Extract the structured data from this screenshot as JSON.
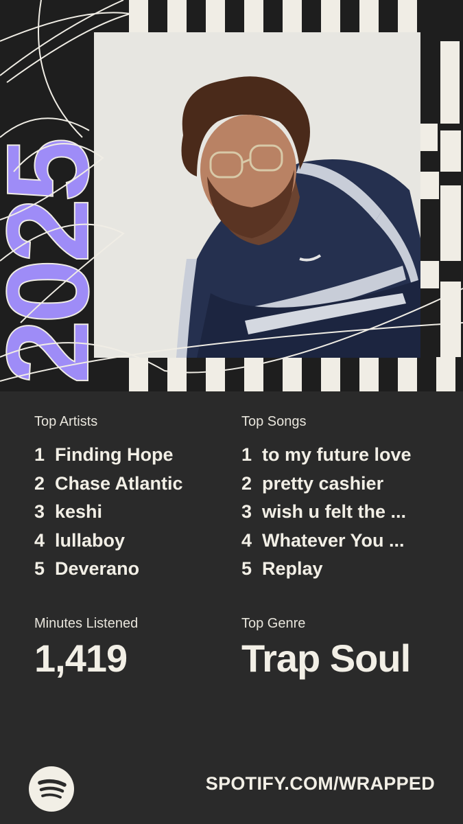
{
  "year": "2025",
  "top_artists": {
    "label": "Top Artists",
    "items": [
      {
        "rank": "1",
        "name": "Finding Hope"
      },
      {
        "rank": "2",
        "name": "Chase Atlantic"
      },
      {
        "rank": "3",
        "name": "keshi"
      },
      {
        "rank": "4",
        "name": "lullaboy"
      },
      {
        "rank": "5",
        "name": "Deverano"
      }
    ]
  },
  "top_songs": {
    "label": "Top Songs",
    "items": [
      {
        "rank": "1",
        "name": "to my future love"
      },
      {
        "rank": "2",
        "name": "pretty cashier"
      },
      {
        "rank": "3",
        "name": "wish u felt the ..."
      },
      {
        "rank": "4",
        "name": "Whatever You ..."
      },
      {
        "rank": "5",
        "name": "Replay"
      }
    ]
  },
  "minutes": {
    "label": "Minutes Listened",
    "value": "1,419"
  },
  "genre": {
    "label": "Top Genre",
    "value": "Trap Soul"
  },
  "footer": {
    "url": "SPOTIFY.COM/WRAPPED",
    "logo_icon": "spotify-logo-icon"
  },
  "colors": {
    "background": "#2a2a2a",
    "accent": "#9e8cf7",
    "text": "#f2efe6"
  }
}
